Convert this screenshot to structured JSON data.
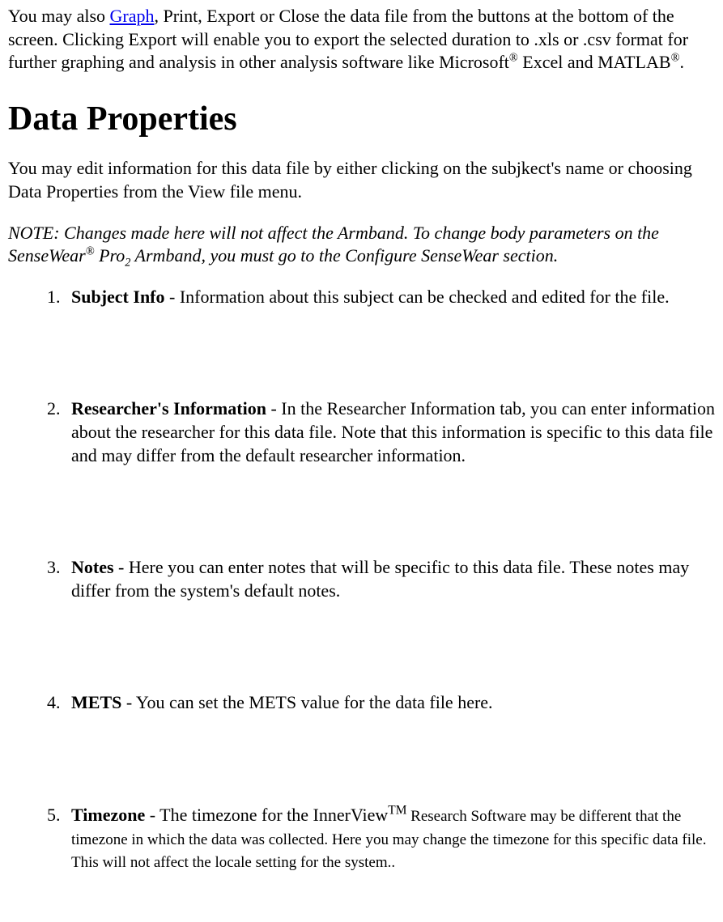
{
  "intro": {
    "pre": "You may also ",
    "link": "Graph",
    "post1": ", Print, Export or Close the data file from the buttons at the bottom of the screen. Clicking Export will enable you to export the selected duration to .xls or .csv format for further graphing and analysis in other analysis software like Microsoft",
    "reg1": "®",
    "post2": " Excel and MATLAB",
    "reg2": "®",
    "post3": "."
  },
  "heading": "Data Properties",
  "para2": "You may edit information for this data file by either clicking on the subjkect's name or choosing Data Properties from the View file menu.",
  "note": {
    "pre": "NOTE: Changes made here will not affect the Armband. To change body parameters on the SenseWear",
    "reg": "®",
    "mid": " Pro",
    "sub": "2",
    "post": " Armband, you must go to the Configure SenseWear section."
  },
  "items": [
    {
      "title": "Subject Info",
      "body": " - Information about this subject can be checked and edited for the file."
    },
    {
      "title": "Researcher's Information",
      "body": " - In the Researcher Information tab, you can enter information about the researcher for this data file. Note that this information is specific to this data file and may differ from the default researcher information."
    },
    {
      "title": "Notes",
      "body": " - Here you can enter notes that will be specific to this data file. These notes may differ from the system's default notes."
    },
    {
      "title": "METS",
      "body": " - You can set the METS value for the data file here."
    },
    {
      "title": "Timezone",
      "pre": " - The timezone for the InnerView",
      "tm": "TM",
      "post": " Research Software may be different that the timezone in which the data was collected. Here you may change the timezone for this specific data file. This will not affect the locale setting for the system.."
    }
  ]
}
